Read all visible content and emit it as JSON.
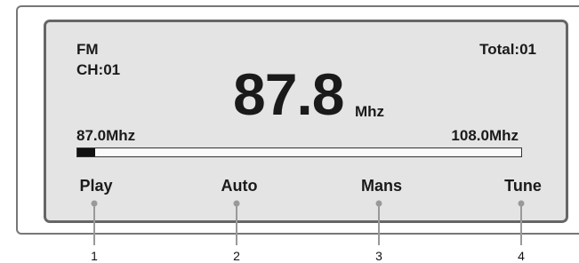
{
  "display": {
    "band": "FM",
    "channel": "CH:01",
    "total": "Total:01",
    "frequency": "87.8",
    "frequency_unit": "Mhz",
    "range_min": "87.0Mhz",
    "range_max": "108.0Mhz",
    "tuning_position_fraction": 0.04
  },
  "buttons": [
    {
      "label": "Play",
      "callout": "1"
    },
    {
      "label": "Auto",
      "callout": "2"
    },
    {
      "label": "Mans",
      "callout": "3"
    },
    {
      "label": "Tune",
      "callout": "4"
    }
  ],
  "colors": {
    "lcd_background": "#e4e4e4",
    "lcd_border": "#666666",
    "leader": "#999999"
  }
}
